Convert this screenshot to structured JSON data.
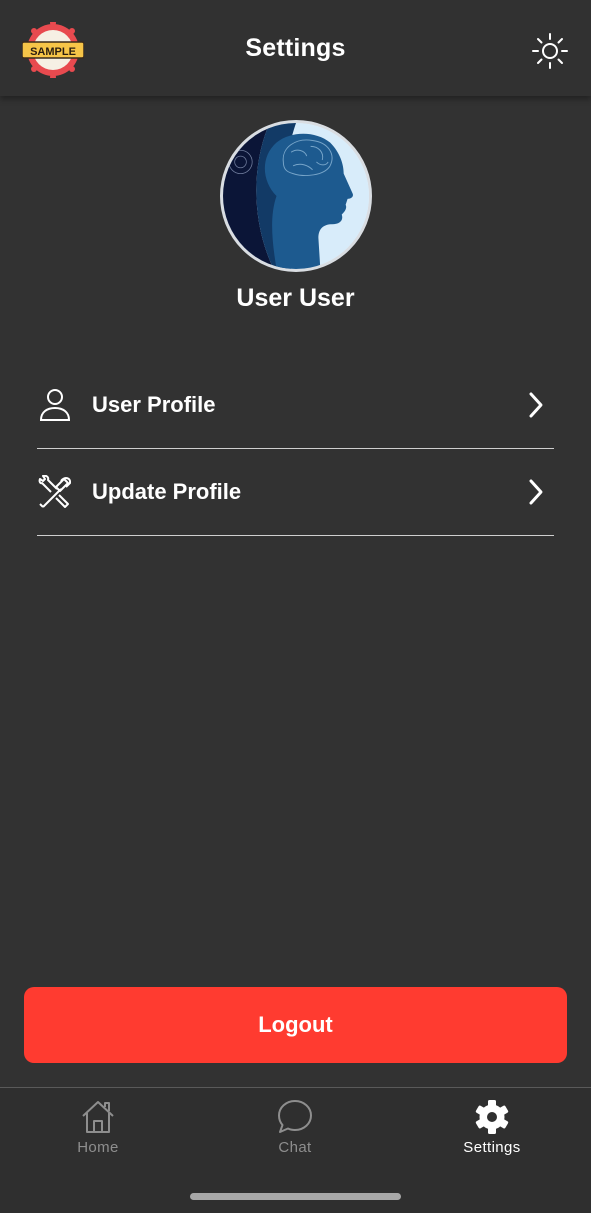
{
  "header": {
    "title": "Settings",
    "logo_text": "SAMPLE",
    "theme_toggle_icon": "sun-icon"
  },
  "profile": {
    "name": "User User",
    "avatar_icon": "head-profile-avatar"
  },
  "menu": {
    "items": [
      {
        "label": "User Profile",
        "icon": "user-icon"
      },
      {
        "label": "Update Profile",
        "icon": "tools-icon"
      }
    ]
  },
  "logout": {
    "label": "Logout",
    "color": "#ff3b30"
  },
  "tabs": [
    {
      "label": "Home",
      "icon": "home-icon",
      "active": false
    },
    {
      "label": "Chat",
      "icon": "chat-icon",
      "active": false
    },
    {
      "label": "Settings",
      "icon": "gear-icon",
      "active": true
    }
  ],
  "colors": {
    "background": "#323232",
    "accent": "#ff3b30",
    "inactive_tab": "#8e8e8e"
  }
}
